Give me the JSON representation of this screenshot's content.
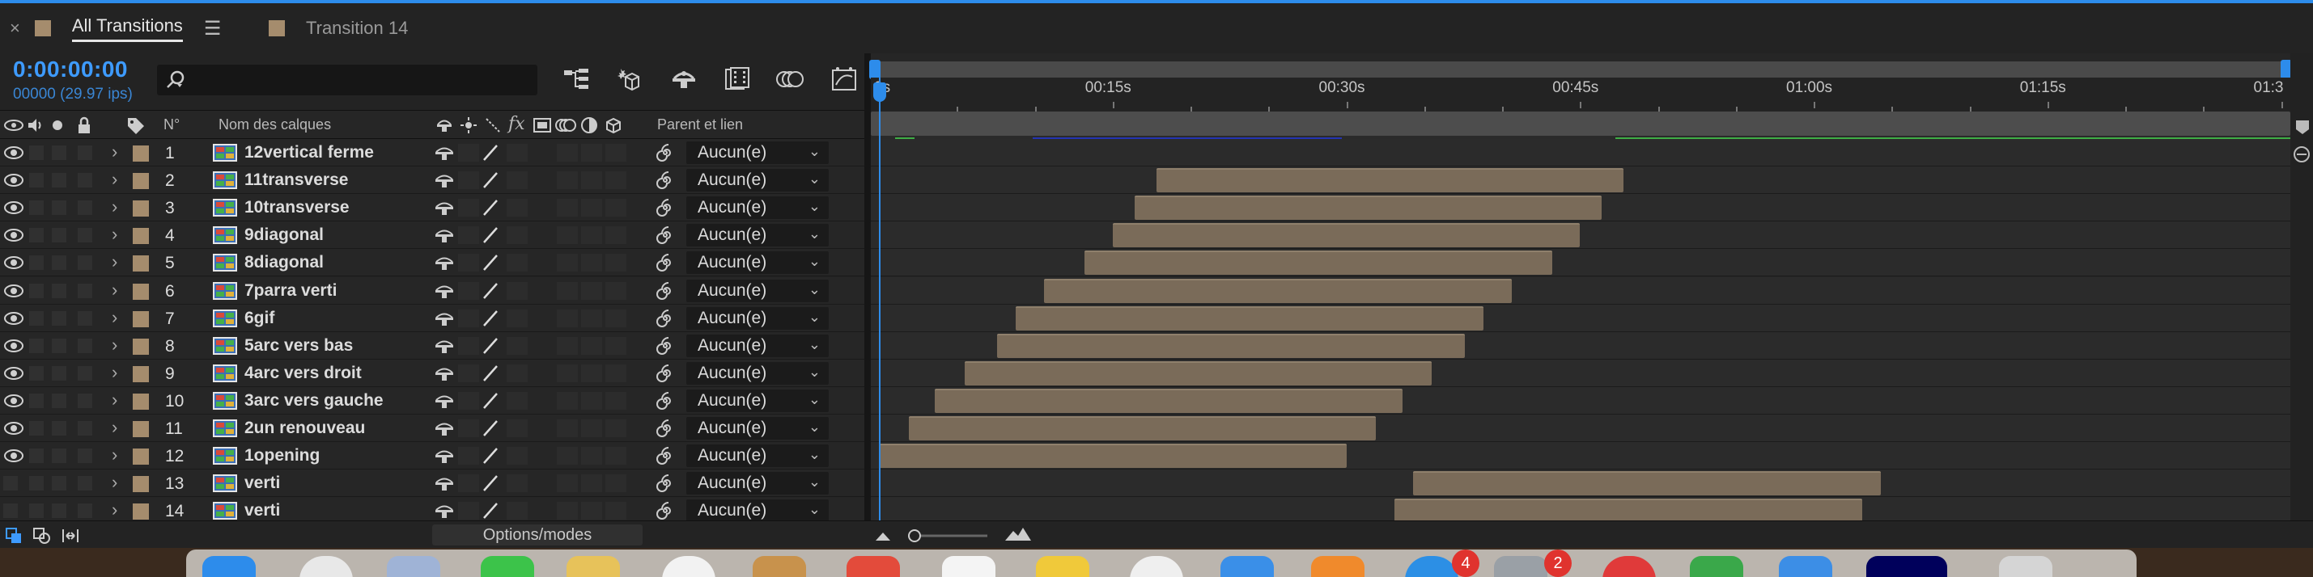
{
  "tabs": [
    {
      "label": "All Transitions",
      "active": true,
      "close": "×",
      "menu": "☰"
    },
    {
      "label": "Transition 14",
      "active": false
    }
  ],
  "header": {
    "timecode": "0:00:00:00",
    "fps": "00000 (29.97 ips)",
    "search_icon": "search-icon"
  },
  "columns": {
    "num": "N°",
    "layer_name": "Nom des calques",
    "parent": "Parent et lien",
    "fx": "fx"
  },
  "layers": [
    {
      "num": "1",
      "name": "12vertical ferme",
      "parent": "Aucun(e)",
      "visible": true,
      "start": 0.0,
      "end": 0.0
    },
    {
      "num": "2",
      "name": "11transverse",
      "parent": "Aucun(e)",
      "visible": true,
      "start": 17.8,
      "end": 47.8
    },
    {
      "num": "3",
      "name": "10transverse",
      "parent": "Aucun(e)",
      "visible": true,
      "start": 16.4,
      "end": 46.4
    },
    {
      "num": "4",
      "name": "9diagonal",
      "parent": "Aucun(e)",
      "visible": true,
      "start": 15.0,
      "end": 45.0
    },
    {
      "num": "5",
      "name": "8diagonal",
      "parent": "Aucun(e)",
      "visible": true,
      "start": 13.2,
      "end": 43.2
    },
    {
      "num": "6",
      "name": "7parra verti",
      "parent": "Aucun(e)",
      "visible": true,
      "start": 10.6,
      "end": 40.6
    },
    {
      "num": "7",
      "name": "6gif",
      "parent": "Aucun(e)",
      "visible": true,
      "start": 8.8,
      "end": 38.8
    },
    {
      "num": "8",
      "name": "5arc vers bas",
      "parent": "Aucun(e)",
      "visible": true,
      "start": 7.6,
      "end": 37.6
    },
    {
      "num": "9",
      "name": "4arc vers droit",
      "parent": "Aucun(e)",
      "visible": true,
      "start": 5.5,
      "end": 35.5
    },
    {
      "num": "10",
      "name": "3arc vers gauche",
      "parent": "Aucun(e)",
      "visible": true,
      "start": 3.6,
      "end": 33.6
    },
    {
      "num": "11",
      "name": "2un renouveau",
      "parent": "Aucun(e)",
      "visible": true,
      "start": 1.9,
      "end": 31.9
    },
    {
      "num": "12",
      "name": "1opening",
      "parent": "Aucun(e)",
      "visible": true,
      "start": 0.0,
      "end": 30.0
    },
    {
      "num": "13",
      "name": "verti",
      "parent": "Aucun(e)",
      "visible": false,
      "start": 34.3,
      "end": 64.3
    },
    {
      "num": "14",
      "name": "verti",
      "parent": "Aucun(e)",
      "visible": false,
      "start": 33.1,
      "end": 63.1
    }
  ],
  "ruler": {
    "ticks": [
      "0s",
      "00:15s",
      "00:30s",
      "00:45s",
      "01:00s",
      "01:15s",
      "01:3"
    ],
    "tick_seconds": [
      0,
      15,
      30,
      45,
      60,
      75,
      90
    ]
  },
  "bottom": {
    "options_modes": "Options/modes"
  },
  "dock_badges": [
    "4",
    "2"
  ],
  "colors": {
    "accent": "#2d8ceb",
    "label_chip": "#a58c6d",
    "layer_bar": "#7a6b59",
    "render_green": "#3fae45",
    "render_blue": "#2334b3"
  }
}
